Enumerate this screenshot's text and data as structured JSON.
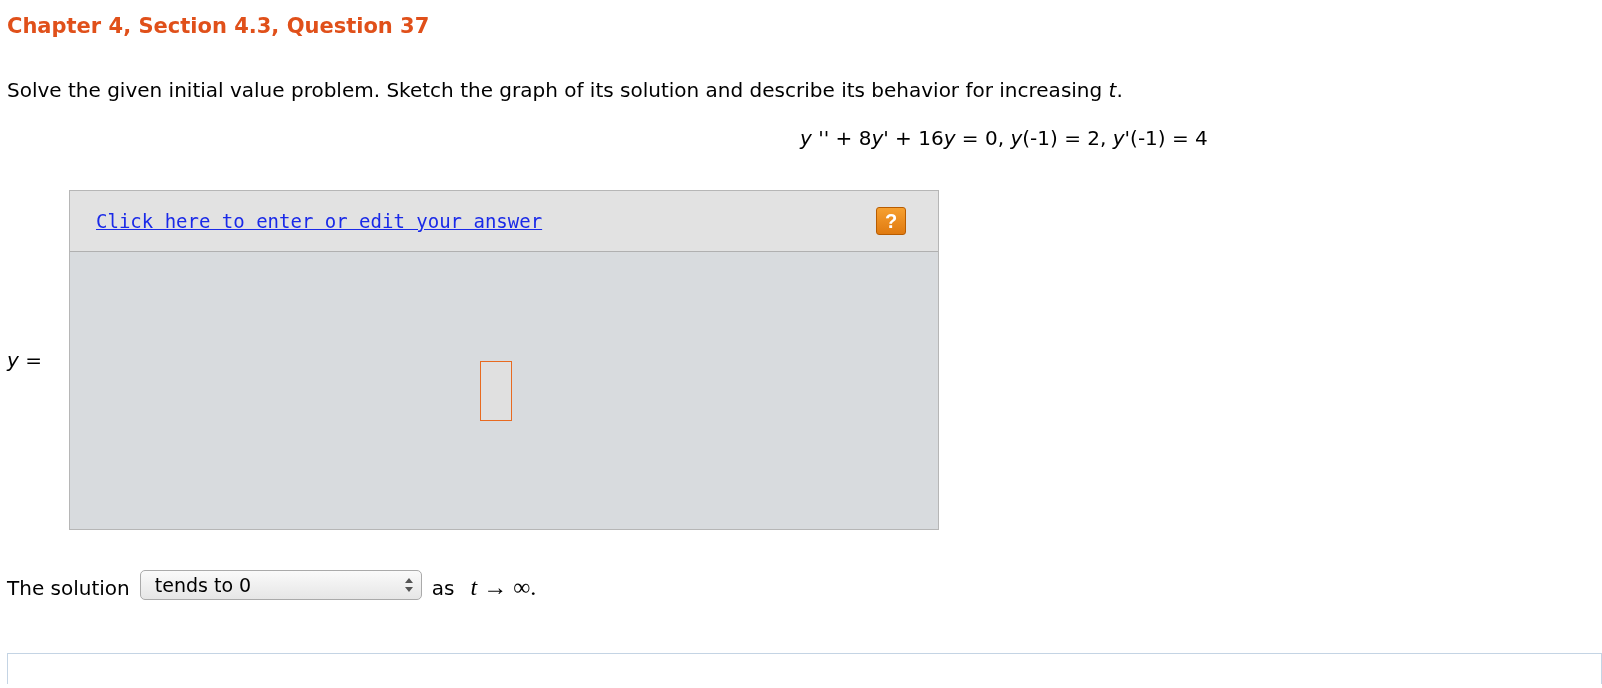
{
  "title": "Chapter 4, Section 4.3, Question 37",
  "problem": "Solve the given initial value problem. Sketch the graph of its solution and describe its behavior for increasing *t*.",
  "equation": [
    {
      "kind": "var",
      "text": "y"
    },
    {
      "kind": "text",
      "text": " '' + 8"
    },
    {
      "kind": "var",
      "text": "y"
    },
    {
      "kind": "text",
      "text": "' + 16"
    },
    {
      "kind": "var",
      "text": "y"
    },
    {
      "kind": "text",
      "text": " = 0, "
    },
    {
      "kind": "var",
      "text": "y"
    },
    {
      "kind": "text",
      "text": "(-1) = 2, "
    },
    {
      "kind": "var",
      "text": "y"
    },
    {
      "kind": "text",
      "text": "'(-1) = 4"
    }
  ],
  "answer": {
    "label": "*y* =",
    "edit_link": "Click here to enter or edit your answer",
    "help_button": "?"
  },
  "behavior": {
    "prefix": "The solution",
    "dropdown": {
      "value": "tends to 0"
    },
    "suffix": "as",
    "limit": "*t* → ∞."
  }
}
